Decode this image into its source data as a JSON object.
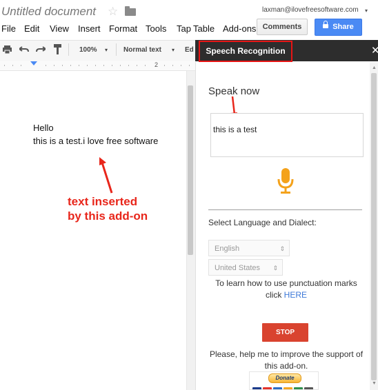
{
  "header": {
    "doc_title": "Untitled document",
    "account_email": "laxman@ilovefreesoftware.com",
    "account_caret": "▾",
    "star_glyph": "☆"
  },
  "menu": {
    "items": [
      "File",
      "Edit",
      "View",
      "Insert",
      "Format",
      "Tools",
      "Tap",
      "Table",
      "Add-ons"
    ],
    "comments_label": "Comments",
    "share_label": "Share"
  },
  "toolbar": {
    "zoom": "100%",
    "style": "Normal text",
    "font_partial": "Ed",
    "dropdown_caret": "▾"
  },
  "ruler": {
    "mark_2": "2"
  },
  "document": {
    "line1": "Hello",
    "line2": "this is a test.i love free software"
  },
  "annotation": {
    "line1": "text inserted",
    "line2": "by this add-on"
  },
  "sidebar": {
    "title": "Speech Recognition",
    "close_glyph": "✕",
    "speak_heading": "Speak now",
    "transcript": "this is a test",
    "language_label": "Select Language and Dialect:",
    "language_value": "English",
    "dialect_value": "United States",
    "punct_help": "To learn how to use punctuation marks click",
    "punct_link": "HERE",
    "stop_label": "STOP",
    "support_text": "Please, help me to improve the support of this add-on.",
    "donate_label": "Donate",
    "mic_color": "#f4a21b",
    "stop_color": "#d9432f"
  },
  "colors": {
    "share_blue": "#4a8af4",
    "annotation_red": "#e8261b"
  }
}
